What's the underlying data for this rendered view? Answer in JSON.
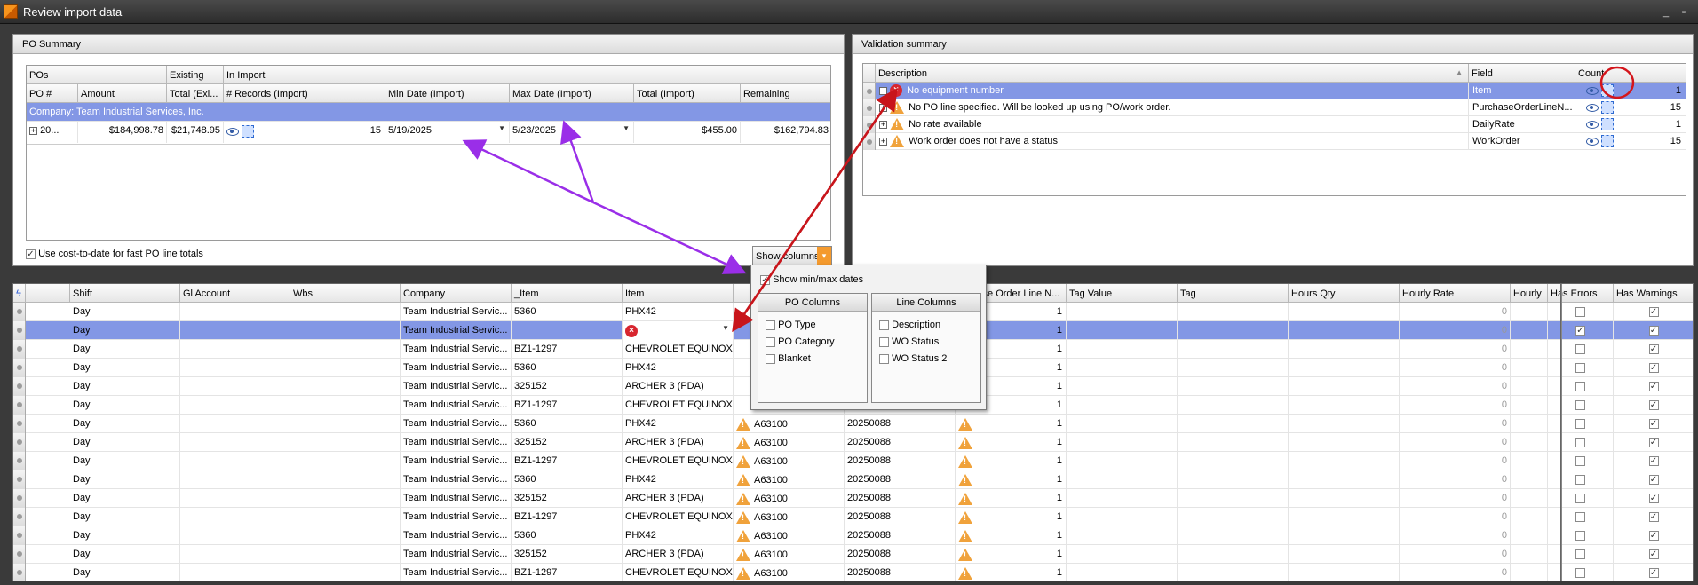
{
  "window": {
    "title": "Review import data",
    "min": "_",
    "restore": "▫"
  },
  "po_summary": {
    "title": "PO Summary",
    "group_headers": {
      "pos": "POs",
      "existing": "Existing",
      "in_import": "In Import"
    },
    "columns": [
      "PO #",
      "Amount",
      "Total (Exi...",
      "# Records (Import)",
      "Min Date (Import)",
      "Max Date (Import)",
      "Total (Import)",
      "Remaining"
    ],
    "group_row": "Company: Team Industrial Services, Inc.",
    "row": {
      "po": "20...",
      "amount": "$184,998.78",
      "total_existing": "$21,748.95",
      "records": "15",
      "min_date": "5/19/2025",
      "max_date": "5/23/2025",
      "total_import": "$455.00",
      "remaining": "$162,794.83"
    },
    "checkbox_label": "Use cost-to-date for fast PO line totals",
    "show_columns_label": "Show columns"
  },
  "validation": {
    "title": "Validation summary",
    "columns": [
      "Description",
      "Field",
      "Count"
    ],
    "rows": [
      {
        "type": "error",
        "description": "No equipment number",
        "field": "Item",
        "count": "1"
      },
      {
        "type": "warn",
        "description": "No PO line specified. Will be looked up using PO/work order.",
        "field": "PurchaseOrderLineN...",
        "count": "15"
      },
      {
        "type": "warn",
        "description": "No rate available",
        "field": "DailyRate",
        "count": "1"
      },
      {
        "type": "warn",
        "description": "Work order does not have a status",
        "field": "WorkOrder",
        "count": "15"
      }
    ]
  },
  "columns_popup": {
    "show_minmax": "Show min/max dates",
    "po_columns_title": "PO Columns",
    "po_columns": [
      "PO Type",
      "PO Category",
      "Blanket"
    ],
    "line_columns_title": "Line Columns",
    "line_columns": [
      "Description",
      "WO Status",
      "WO Status 2"
    ]
  },
  "main_grid": {
    "columns": [
      "Shift",
      "Gl Account",
      "Wbs",
      "Company",
      "_Item",
      "Item",
      "",
      "",
      "urchase Order Line N...",
      "Tag Value",
      "Tag",
      "Hours Qty",
      "Hourly Rate",
      "Hourly",
      "Has Errors",
      "Has Warnings"
    ],
    "rows": [
      {
        "shift": "Day",
        "company": "Team Industrial Servic...",
        "item_code": "5360",
        "item": "PHX42",
        "wo": "",
        "po": "",
        "line": "1",
        "rate": "0",
        "errors": false,
        "warnings": true,
        "err_item": false,
        "warn": false
      },
      {
        "shift": "Day",
        "company": "Team Industrial Servic...",
        "item_code": "",
        "item": "",
        "wo": "",
        "po": "",
        "line": "1",
        "rate": "0",
        "errors": true,
        "warnings": true,
        "err_item": true,
        "warn": false,
        "selected": true
      },
      {
        "shift": "Day",
        "company": "Team Industrial Servic...",
        "item_code": "BZ1-1297",
        "item": "CHEVROLET EQUINOX",
        "wo": "",
        "po": "",
        "line": "1",
        "rate": "0",
        "errors": false,
        "warnings": true,
        "warn": false
      },
      {
        "shift": "Day",
        "company": "Team Industrial Servic...",
        "item_code": "5360",
        "item": "PHX42",
        "wo": "",
        "po": "",
        "line": "1",
        "rate": "0",
        "errors": false,
        "warnings": true,
        "warn": false
      },
      {
        "shift": "Day",
        "company": "Team Industrial Servic...",
        "item_code": "325152",
        "item": "ARCHER 3 (PDA)",
        "wo": "",
        "po": "",
        "line": "1",
        "rate": "0",
        "errors": false,
        "warnings": true,
        "warn": false
      },
      {
        "shift": "Day",
        "company": "Team Industrial Servic...",
        "item_code": "BZ1-1297",
        "item": "CHEVROLET EQUINOX",
        "wo": "",
        "po": "",
        "line": "1",
        "rate": "0",
        "errors": false,
        "warnings": true,
        "warn": false
      },
      {
        "shift": "Day",
        "company": "Team Industrial Servic...",
        "item_code": "5360",
        "item": "PHX42",
        "wo": "A63100",
        "po": "20250088",
        "line": "1",
        "rate": "0",
        "errors": false,
        "warnings": true,
        "warn": true
      },
      {
        "shift": "Day",
        "company": "Team Industrial Servic...",
        "item_code": "325152",
        "item": "ARCHER 3 (PDA)",
        "wo": "A63100",
        "po": "20250088",
        "line": "1",
        "rate": "0",
        "errors": false,
        "warnings": true,
        "warn": true
      },
      {
        "shift": "Day",
        "company": "Team Industrial Servic...",
        "item_code": "BZ1-1297",
        "item": "CHEVROLET EQUINOX",
        "wo": "A63100",
        "po": "20250088",
        "line": "1",
        "rate": "0",
        "errors": false,
        "warnings": true,
        "warn": true
      },
      {
        "shift": "Day",
        "company": "Team Industrial Servic...",
        "item_code": "5360",
        "item": "PHX42",
        "wo": "A63100",
        "po": "20250088",
        "line": "1",
        "rate": "0",
        "errors": false,
        "warnings": true,
        "warn": true
      },
      {
        "shift": "Day",
        "company": "Team Industrial Servic...",
        "item_code": "325152",
        "item": "ARCHER 3 (PDA)",
        "wo": "A63100",
        "po": "20250088",
        "line": "1",
        "rate": "0",
        "errors": false,
        "warnings": true,
        "warn": true
      },
      {
        "shift": "Day",
        "company": "Team Industrial Servic...",
        "item_code": "BZ1-1297",
        "item": "CHEVROLET EQUINOX",
        "wo": "A63100",
        "po": "20250088",
        "line": "1",
        "rate": "0",
        "errors": false,
        "warnings": true,
        "warn": true
      },
      {
        "shift": "Day",
        "company": "Team Industrial Servic...",
        "item_code": "5360",
        "item": "PHX42",
        "wo": "A63100",
        "po": "20250088",
        "line": "1",
        "rate": "0",
        "errors": false,
        "warnings": true,
        "warn": true
      },
      {
        "shift": "Day",
        "company": "Team Industrial Servic...",
        "item_code": "325152",
        "item": "ARCHER 3 (PDA)",
        "wo": "A63100",
        "po": "20250088",
        "line": "1",
        "rate": "0",
        "errors": false,
        "warnings": true,
        "warn": true
      },
      {
        "shift": "Day",
        "company": "Team Industrial Servic...",
        "item_code": "BZ1-1297",
        "item": "CHEVROLET EQUINOX",
        "wo": "A63100",
        "po": "20250088",
        "line": "1",
        "rate": "0",
        "errors": false,
        "warnings": true,
        "warn": true
      }
    ]
  },
  "colors": {
    "selection": "#8397e5",
    "group_row": "#8397e5",
    "annotation_purple": "#9a2ee8",
    "annotation_red": "#c8151b"
  }
}
